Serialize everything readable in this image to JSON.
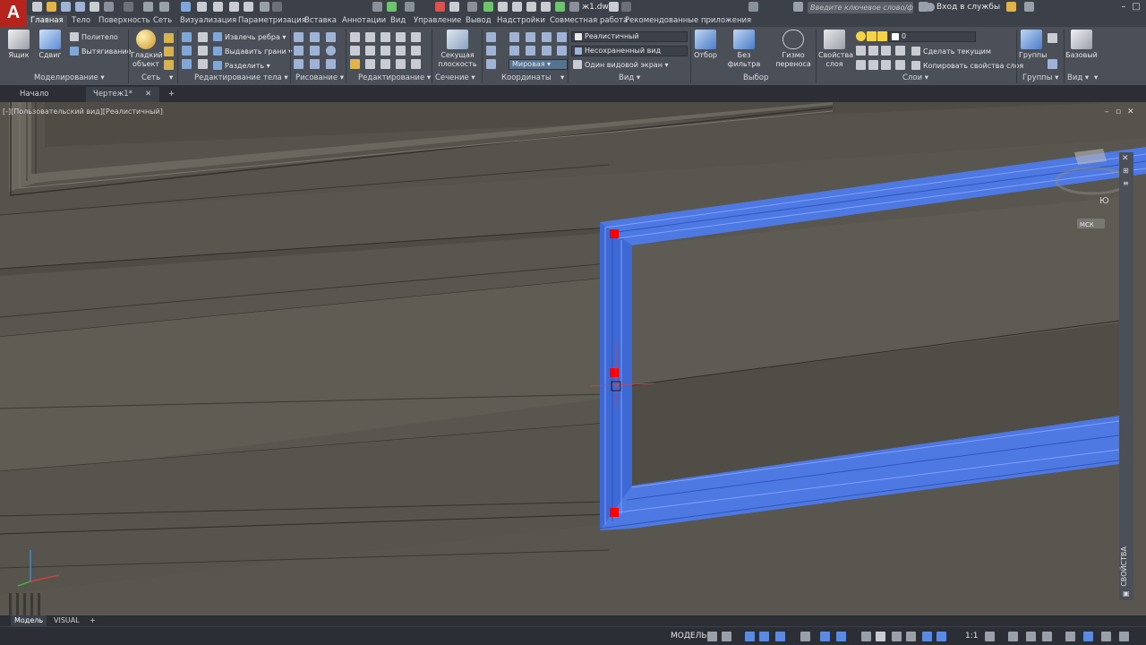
{
  "app": {
    "logo_letter": "A",
    "document_title": "ж1.dw",
    "search_placeholder": "Введите ключевое слово/фразу",
    "signin_label": "Вход в службы"
  },
  "ribbon_tabs": [
    "Главная",
    "Тело",
    "Поверхность",
    "Сеть",
    "Визуализация",
    "Параметризация",
    "Вставка",
    "Аннотации",
    "Вид",
    "Управление",
    "Вывод",
    "Надстройки",
    "Совместная работа",
    "Рекомендованные приложения"
  ],
  "panels": {
    "modeling": {
      "footer": "Моделирование",
      "box": "Ящик",
      "shift": "Сдвиг",
      "polysolid": "Политело",
      "extrude": "Вытягивание"
    },
    "mesh": {
      "footer": "Сеть",
      "smooth_object": "Гладкий объект"
    },
    "solid_editing": {
      "footer": "Редактирование тела",
      "extract_edges": "Извлечь ребра",
      "extrude_faces": "Выдавить грани",
      "separate": "Разделить"
    },
    "drawing": {
      "footer": "Рисование"
    },
    "modify": {
      "footer": "Редактирование"
    },
    "section": {
      "footer": "Сечение",
      "section_plane": "Секущая плоскость"
    },
    "coordinates": {
      "footer": "Координаты",
      "ucs": "Мировая"
    },
    "view": {
      "footer": "Вид",
      "visual_style": "Реалистичный",
      "named_view": "Несохраненный вид",
      "viewport_config": "Один видовой экран"
    },
    "selection": {
      "footer": "Выбор",
      "culling": "Отбор",
      "no_filter": "Без фильтра",
      "gizmo": "Гизмо переноса"
    },
    "layers": {
      "footer": "Слои",
      "layer_properties": "Свойства слоя",
      "layer_current": "0",
      "make_current": "Сделать текущим",
      "match_layer": "Копировать свойства слоя"
    },
    "groups": {
      "footer": "Группы",
      "groups": "Группы"
    },
    "view2": {
      "footer": "Вид",
      "base": "Базовый"
    }
  },
  "file_tabs": [
    "Начало",
    "Чертеж1*"
  ],
  "viewport": {
    "label": "[-][Пользовательский вид][Реалистичный]",
    "wcs_label": "МСК",
    "viewcube_letter": "Ю"
  },
  "palette": {
    "title": "СВОЙСТВА"
  },
  "layout_tabs": [
    "Модель",
    "VISUAL"
  ],
  "status": {
    "model": "МОДЕЛЬ",
    "scale": "1:1"
  },
  "colors": {
    "selection_blue": "#4d7cf0",
    "grip_red": "#ff0000",
    "wall": "#59574f",
    "ribbon": "#4a4f58"
  }
}
